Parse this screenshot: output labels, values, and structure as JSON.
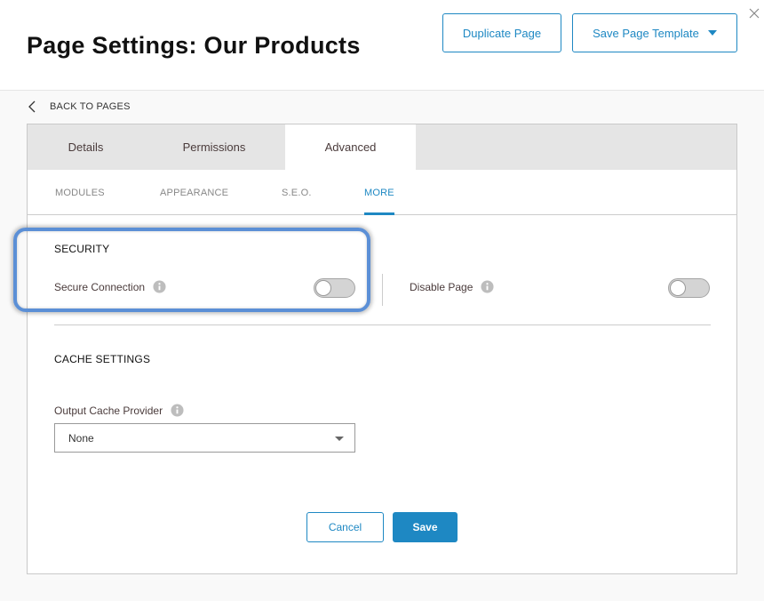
{
  "header": {
    "title": "Page Settings: Our Products",
    "duplicate_label": "Duplicate Page",
    "save_template_label": "Save Page Template",
    "close_icon": "close-icon"
  },
  "nav": {
    "back_label": "BACK TO PAGES",
    "back_icon": "chevron-left-icon"
  },
  "tabs": [
    {
      "label": "Details",
      "active": false
    },
    {
      "label": "Permissions",
      "active": false
    },
    {
      "label": "Advanced",
      "active": true
    }
  ],
  "subtabs": [
    {
      "label": "MODULES",
      "active": false
    },
    {
      "label": "APPEARANCE",
      "active": false
    },
    {
      "label": "S.E.O.",
      "active": false
    },
    {
      "label": "MORE",
      "active": true
    }
  ],
  "security": {
    "title": "SECURITY",
    "secure_connection": {
      "label": "Secure Connection",
      "enabled": false,
      "icon": "info-icon"
    },
    "disable_page": {
      "label": "Disable Page",
      "enabled": false,
      "icon": "info-icon"
    }
  },
  "cache": {
    "title": "CACHE SETTINGS",
    "provider_label": "Output Cache Provider",
    "provider_value": "None",
    "icon": "info-icon"
  },
  "actions": {
    "cancel_label": "Cancel",
    "save_label": "Save"
  },
  "colors": {
    "accent": "#1e88c3",
    "highlight": "#5b8fd6"
  }
}
